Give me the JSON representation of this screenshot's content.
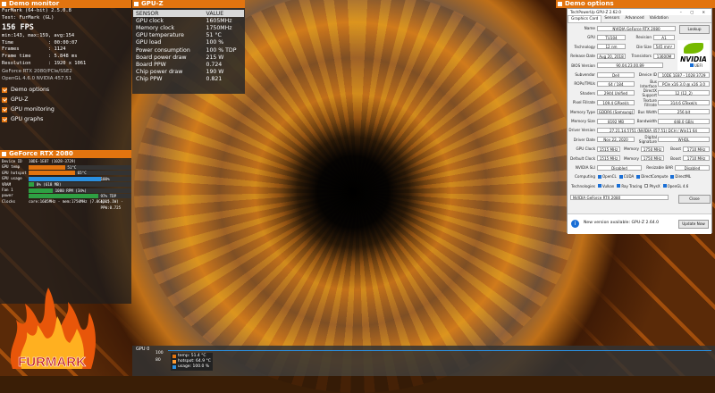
{
  "furmark": {
    "header": "Demo monitor",
    "title": "FurMark (64-bit) 2.5.0.8",
    "test": "Test: FurMark (GL)",
    "fps": "156 FPS",
    "minmax": "min:143, max:159, avg:154",
    "stats": [
      {
        "k": "Time",
        "v": ": 00:00:07"
      },
      {
        "k": "Frames",
        "v": ": 1124"
      },
      {
        "k": "Frame time",
        "v": ": 5.848 ms"
      },
      {
        "k": "Resolution",
        "v": ": 1920 x 1061"
      }
    ],
    "gpu_name": "GeForce RTX 2080/PCIe/SSE2",
    "gl": "OpenGL 4.6.0 NVIDIA 457.51",
    "options": [
      "Demo options",
      "GPU-Z",
      "GPU monitoring",
      "GPU graphs"
    ]
  },
  "gpu_panel": {
    "header": "GeForce RTX 2080",
    "rows": [
      {
        "k": "Device ID",
        "v": "10DE-1E87 (1028-3729)"
      },
      {
        "k": "GPU temp",
        "v": "51°C",
        "pct": 51,
        "color": "#e2740f"
      },
      {
        "k": "GPU hotspot",
        "v": "65°C",
        "pct": 65,
        "color": "#e2740f"
      },
      {
        "k": "GPU usage",
        "v": "100%",
        "pct": 100,
        "color": "#2a8fe0"
      },
      {
        "k": "VRAM",
        "v": "8% (618 MB)",
        "pct": 8,
        "color": "#2ea043"
      },
      {
        "k": "Fan 1",
        "v": "1080 RPM (34%)",
        "pct": 34,
        "color": "#2ea043"
      },
      {
        "k": "power",
        "v": "97% TDP (215.1W) - PPW:0.725",
        "pct": 97,
        "color": "#2ea043"
      },
      {
        "k": "Clocks",
        "v": "core:1605MHz - mem:1750MHz (7.0Gbps)"
      }
    ]
  },
  "gpuz": {
    "header": "GPU-Z",
    "columns": [
      "SENSOR",
      "VALUE"
    ],
    "rows": [
      [
        "GPU clock",
        "1605MHz"
      ],
      [
        "Memory clock",
        "1750MHz"
      ],
      [
        "GPU temperature",
        "51 °C"
      ],
      [
        "GPU load",
        "100 %"
      ],
      [
        "Power consumption",
        "100 % TDP"
      ],
      [
        "Board power draw",
        "215 W"
      ],
      [
        "Board PPW",
        "0.724"
      ],
      [
        "Chip power draw",
        "190 W"
      ],
      [
        "Chip PPW",
        "0.821"
      ]
    ]
  },
  "demo_options": {
    "header": "Demo options"
  },
  "techpowerup": {
    "title": "TechPowerUp GPU-Z 2.62.0",
    "tabs": [
      "Graphics Card",
      "Sensors",
      "Advanced",
      "Validation"
    ],
    "lookup": "Lookup",
    "uefi": "UEFI",
    "name_label": "Name",
    "name": "NVIDIA GeForce RTX 2080",
    "gpu_label": "GPU",
    "gpu": "TU104",
    "revision_label": "Revision",
    "revision": "A1",
    "tech_label": "Technology",
    "tech": "12 nm",
    "die_label": "Die Size",
    "die": "545 mm²",
    "release_label": "Release Date",
    "release": "Aug 20, 2018",
    "transistors_label": "Transistors",
    "transistors": "13600M",
    "bios_label": "BIOS Version",
    "bios": "90.04.23.00.89",
    "subvendor_label": "Subvendor",
    "subvendor": "Dell",
    "devid_label": "Device ID",
    "devid": "10DE 1E87 - 1028 3729",
    "rops_label": "ROPs/TMUs",
    "rops": "64 / 184",
    "bus_label": "Bus Interface",
    "bus": "PCIe x16 3.0 @ x16 3.0",
    "shaders_label": "Shaders",
    "shaders": "2944 Unified",
    "dx_label": "DirectX Support",
    "dx": "12 (12_2)",
    "pixel_label": "Pixel Fillrate",
    "pixel": "109.4 GPixel/s",
    "texture_label": "Texture Fillrate",
    "texture": "314.6 GTexel/s",
    "memtype_label": "Memory Type",
    "memtype": "GDDR6 (Samsung)",
    "buswidth_label": "Bus Width",
    "buswidth": "256 bit",
    "memsize_label": "Memory Size",
    "memsize": "8192 MB",
    "bandwidth_label": "Bandwidth",
    "bandwidth": "448.0 GB/s",
    "driver_label": "Driver Version",
    "driver": "27.21.14.5751 (NVIDIA 457.51) DCH / Win11 64",
    "driverdate_label": "Driver Date",
    "driverdate": "Nov 22, 2020",
    "sig_label": "Digital Signature",
    "sig": "WHQL",
    "gpuclock_label": "GPU Clock",
    "gpuclock": "1515 MHz",
    "mem_label": "Memory",
    "memclock": "1750 MHz",
    "boost_label": "Boost",
    "boost": "1710 MHz",
    "defclock_label": "Default Clock",
    "defclock": "1515 MHz",
    "defmem": "1750 MHz",
    "defboost": "1710 MHz",
    "sli_label": "NVIDIA SLI",
    "sli": "Disabled",
    "bar_label": "Resizable BAR",
    "bar": "Disabled",
    "computing_label": "Computing",
    "computing": [
      {
        "n": "OpenCL",
        "on": true
      },
      {
        "n": "CUDA",
        "on": true
      },
      {
        "n": "DirectCompute",
        "on": true
      },
      {
        "n": "DirectML",
        "on": true
      }
    ],
    "tech2_label": "Technologies",
    "technologies": [
      {
        "n": "Vulkan",
        "on": true
      },
      {
        "n": "Ray Tracing",
        "on": true
      },
      {
        "n": "PhysX",
        "on": false
      },
      {
        "n": "OpenGL 4.6",
        "on": true
      }
    ],
    "selected_gpu": "NVIDIA GeForce RTX 2080",
    "close": "Close",
    "update_msg": "New version available: GPU-Z 2.64.0",
    "update_btn": "Update Now"
  },
  "graph": {
    "label": "GPU 0",
    "ticks": [
      "100",
      "80"
    ],
    "legend": [
      {
        "name": "temp: 51.4 °C",
        "color": "#e2740f"
      },
      {
        "name": "hotspot: 64.9 °C",
        "color": "#ff9a30"
      },
      {
        "name": "usage: 100.0 %",
        "color": "#2a8fe0"
      }
    ]
  },
  "logo_text": "FURMARK"
}
